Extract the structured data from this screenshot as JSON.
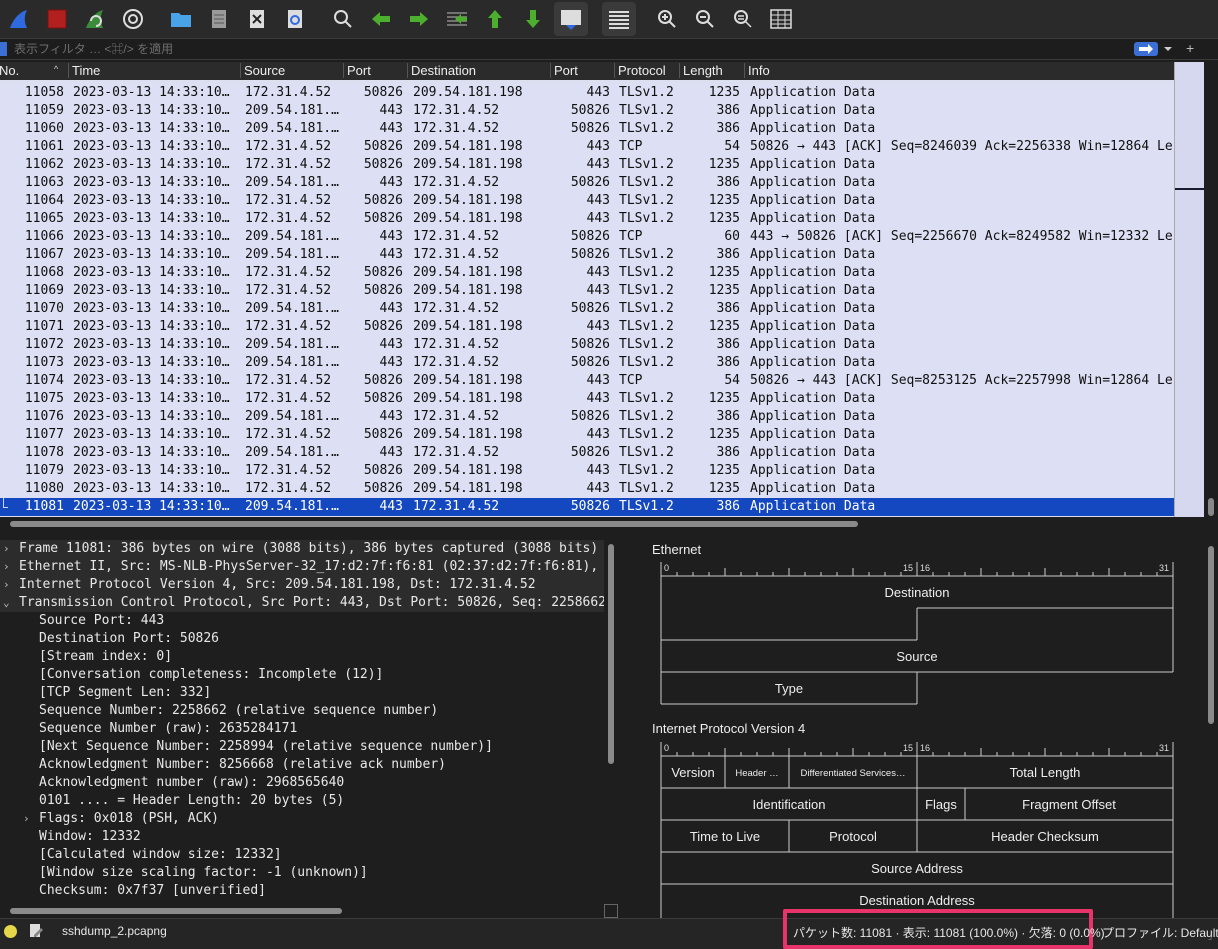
{
  "toolbar": {
    "buttons": [
      "shark-fin-icon",
      "stop-capture-icon",
      "restart-capture-icon",
      "capture-options-icon",
      "open-folder-icon",
      "file-document-icon",
      "close-file-icon",
      "reload-icon",
      "find-packet-icon",
      "go-back-icon",
      "go-forward-icon",
      "go-to-packet-icon",
      "go-first-icon",
      "go-last-icon",
      "auto-scroll-icon",
      "colorize-icon",
      "zoom-in-icon",
      "zoom-out-icon",
      "zoom-normal-icon",
      "resize-columns-icon"
    ]
  },
  "filter": {
    "placeholder": "表示フィルタ … <⌘/> を適用"
  },
  "packet_list": {
    "columns": [
      "No.",
      "Time",
      "Source",
      "Port",
      "Destination",
      "Port",
      "Protocol",
      "Length",
      "Info"
    ],
    "rows": [
      {
        "no": "11058",
        "time": "2023-03-13 14:33:10…",
        "src": "172.31.4.52",
        "sport": "50826",
        "dst": "209.54.181.198",
        "dport": "443",
        "proto": "TLSv1.2",
        "len": "1235",
        "info": "Application Data"
      },
      {
        "no": "11059",
        "time": "2023-03-13 14:33:10…",
        "src": "209.54.181.…",
        "sport": "443",
        "dst": "172.31.4.52",
        "dport": "50826",
        "proto": "TLSv1.2",
        "len": "386",
        "info": "Application Data"
      },
      {
        "no": "11060",
        "time": "2023-03-13 14:33:10…",
        "src": "209.54.181.…",
        "sport": "443",
        "dst": "172.31.4.52",
        "dport": "50826",
        "proto": "TLSv1.2",
        "len": "386",
        "info": "Application Data"
      },
      {
        "no": "11061",
        "time": "2023-03-13 14:33:10…",
        "src": "172.31.4.52",
        "sport": "50826",
        "dst": "209.54.181.198",
        "dport": "443",
        "proto": "TCP",
        "len": "54",
        "info": "50826 → 443 [ACK] Seq=8246039 Ack=2256338 Win=12864 Le"
      },
      {
        "no": "11062",
        "time": "2023-03-13 14:33:10…",
        "src": "172.31.4.52",
        "sport": "50826",
        "dst": "209.54.181.198",
        "dport": "443",
        "proto": "TLSv1.2",
        "len": "1235",
        "info": "Application Data"
      },
      {
        "no": "11063",
        "time": "2023-03-13 14:33:10…",
        "src": "209.54.181.…",
        "sport": "443",
        "dst": "172.31.4.52",
        "dport": "50826",
        "proto": "TLSv1.2",
        "len": "386",
        "info": "Application Data"
      },
      {
        "no": "11064",
        "time": "2023-03-13 14:33:10…",
        "src": "172.31.4.52",
        "sport": "50826",
        "dst": "209.54.181.198",
        "dport": "443",
        "proto": "TLSv1.2",
        "len": "1235",
        "info": "Application Data"
      },
      {
        "no": "11065",
        "time": "2023-03-13 14:33:10…",
        "src": "172.31.4.52",
        "sport": "50826",
        "dst": "209.54.181.198",
        "dport": "443",
        "proto": "TLSv1.2",
        "len": "1235",
        "info": "Application Data"
      },
      {
        "no": "11066",
        "time": "2023-03-13 14:33:10…",
        "src": "209.54.181.…",
        "sport": "443",
        "dst": "172.31.4.52",
        "dport": "50826",
        "proto": "TCP",
        "len": "60",
        "info": "443 → 50826 [ACK] Seq=2256670 Ack=8249582 Win=12332 Le"
      },
      {
        "no": "11067",
        "time": "2023-03-13 14:33:10…",
        "src": "209.54.181.…",
        "sport": "443",
        "dst": "172.31.4.52",
        "dport": "50826",
        "proto": "TLSv1.2",
        "len": "386",
        "info": "Application Data"
      },
      {
        "no": "11068",
        "time": "2023-03-13 14:33:10…",
        "src": "172.31.4.52",
        "sport": "50826",
        "dst": "209.54.181.198",
        "dport": "443",
        "proto": "TLSv1.2",
        "len": "1235",
        "info": "Application Data"
      },
      {
        "no": "11069",
        "time": "2023-03-13 14:33:10…",
        "src": "172.31.4.52",
        "sport": "50826",
        "dst": "209.54.181.198",
        "dport": "443",
        "proto": "TLSv1.2",
        "len": "1235",
        "info": "Application Data"
      },
      {
        "no": "11070",
        "time": "2023-03-13 14:33:10…",
        "src": "209.54.181.…",
        "sport": "443",
        "dst": "172.31.4.52",
        "dport": "50826",
        "proto": "TLSv1.2",
        "len": "386",
        "info": "Application Data"
      },
      {
        "no": "11071",
        "time": "2023-03-13 14:33:10…",
        "src": "172.31.4.52",
        "sport": "50826",
        "dst": "209.54.181.198",
        "dport": "443",
        "proto": "TLSv1.2",
        "len": "1235",
        "info": "Application Data"
      },
      {
        "no": "11072",
        "time": "2023-03-13 14:33:10…",
        "src": "209.54.181.…",
        "sport": "443",
        "dst": "172.31.4.52",
        "dport": "50826",
        "proto": "TLSv1.2",
        "len": "386",
        "info": "Application Data"
      },
      {
        "no": "11073",
        "time": "2023-03-13 14:33:10…",
        "src": "209.54.181.…",
        "sport": "443",
        "dst": "172.31.4.52",
        "dport": "50826",
        "proto": "TLSv1.2",
        "len": "386",
        "info": "Application Data"
      },
      {
        "no": "11074",
        "time": "2023-03-13 14:33:10…",
        "src": "172.31.4.52",
        "sport": "50826",
        "dst": "209.54.181.198",
        "dport": "443",
        "proto": "TCP",
        "len": "54",
        "info": "50826 → 443 [ACK] Seq=8253125 Ack=2257998 Win=12864 Le"
      },
      {
        "no": "11075",
        "time": "2023-03-13 14:33:10…",
        "src": "172.31.4.52",
        "sport": "50826",
        "dst": "209.54.181.198",
        "dport": "443",
        "proto": "TLSv1.2",
        "len": "1235",
        "info": "Application Data"
      },
      {
        "no": "11076",
        "time": "2023-03-13 14:33:10…",
        "src": "209.54.181.…",
        "sport": "443",
        "dst": "172.31.4.52",
        "dport": "50826",
        "proto": "TLSv1.2",
        "len": "386",
        "info": "Application Data"
      },
      {
        "no": "11077",
        "time": "2023-03-13 14:33:10…",
        "src": "172.31.4.52",
        "sport": "50826",
        "dst": "209.54.181.198",
        "dport": "443",
        "proto": "TLSv1.2",
        "len": "1235",
        "info": "Application Data"
      },
      {
        "no": "11078",
        "time": "2023-03-13 14:33:10…",
        "src": "209.54.181.…",
        "sport": "443",
        "dst": "172.31.4.52",
        "dport": "50826",
        "proto": "TLSv1.2",
        "len": "386",
        "info": "Application Data"
      },
      {
        "no": "11079",
        "time": "2023-03-13 14:33:10…",
        "src": "172.31.4.52",
        "sport": "50826",
        "dst": "209.54.181.198",
        "dport": "443",
        "proto": "TLSv1.2",
        "len": "1235",
        "info": "Application Data"
      },
      {
        "no": "11080",
        "time": "2023-03-13 14:33:10…",
        "src": "172.31.4.52",
        "sport": "50826",
        "dst": "209.54.181.198",
        "dport": "443",
        "proto": "TLSv1.2",
        "len": "1235",
        "info": "Application Data"
      },
      {
        "no": "11081",
        "time": "2023-03-13 14:33:10…",
        "src": "209.54.181.…",
        "sport": "443",
        "dst": "172.31.4.52",
        "dport": "50826",
        "proto": "TLSv1.2",
        "len": "386",
        "info": "Application Data",
        "selected": true
      }
    ]
  },
  "details": {
    "rows": [
      {
        "arrow": "›",
        "indent": 0,
        "top": true,
        "text": "Frame 11081: 386 bytes on wire (3088 bits), 386 bytes captured (3088 bits)"
      },
      {
        "arrow": "›",
        "indent": 0,
        "top": true,
        "text": "Ethernet II, Src: MS-NLB-PhysServer-32_17:d2:7f:f6:81 (02:37:d2:7f:f6:81),"
      },
      {
        "arrow": "›",
        "indent": 0,
        "top": true,
        "text": "Internet Protocol Version 4, Src: 209.54.181.198, Dst: 172.31.4.52"
      },
      {
        "arrow": "⌄",
        "indent": 0,
        "top": true,
        "text": "Transmission Control Protocol, Src Port: 443, Dst Port: 50826, Seq: 2258662"
      },
      {
        "arrow": "",
        "indent": 1,
        "text": "Source Port: 443"
      },
      {
        "arrow": "",
        "indent": 1,
        "text": "Destination Port: 50826"
      },
      {
        "arrow": "",
        "indent": 1,
        "text": "[Stream index: 0]"
      },
      {
        "arrow": "",
        "indent": 1,
        "text": "[Conversation completeness: Incomplete (12)]"
      },
      {
        "arrow": "",
        "indent": 1,
        "text": "[TCP Segment Len: 332]"
      },
      {
        "arrow": "",
        "indent": 1,
        "text": "Sequence Number: 2258662    (relative sequence number)"
      },
      {
        "arrow": "",
        "indent": 1,
        "text": "Sequence Number (raw): 2635284171"
      },
      {
        "arrow": "",
        "indent": 1,
        "text": "[Next Sequence Number: 2258994    (relative sequence number)]"
      },
      {
        "arrow": "",
        "indent": 1,
        "text": "Acknowledgment Number: 8256668    (relative ack number)"
      },
      {
        "arrow": "",
        "indent": 1,
        "text": "Acknowledgment number (raw): 2968565640"
      },
      {
        "arrow": "",
        "indent": 1,
        "text": "0101 .... = Header Length: 20 bytes (5)"
      },
      {
        "arrow": "›",
        "indent": 1,
        "text": "Flags: 0x018 (PSH, ACK)"
      },
      {
        "arrow": "",
        "indent": 1,
        "text": "Window: 12332"
      },
      {
        "arrow": "",
        "indent": 1,
        "text": "[Calculated window size: 12332]"
      },
      {
        "arrow": "",
        "indent": 1,
        "text": "[Window size scaling factor: -1 (unknown)]"
      },
      {
        "arrow": "",
        "indent": 1,
        "text": "Checksum: 0x7f37 [unverified]"
      }
    ]
  },
  "diagram": {
    "ethernet_title": "Ethernet",
    "ipv4_title": "Internet Protocol Version 4",
    "bit_labels": {
      "b0": "0",
      "b15": "15",
      "b16": "16",
      "b31": "31"
    },
    "ethernet_fields": {
      "destination": "Destination",
      "source": "Source",
      "type": "Type"
    },
    "ipv4_fields": {
      "version": "Version",
      "header_len": "Header …",
      "dsfield": "Differentiated Services…",
      "total_length": "Total Length",
      "identification": "Identification",
      "flags": "Flags",
      "fragment_offset": "Fragment Offset",
      "ttl": "Time to Live",
      "protocol": "Protocol",
      "header_checksum": "Header Checksum",
      "src_addr": "Source Address",
      "dst_addr": "Destination Address"
    }
  },
  "status": {
    "file": "sshdump_2.pcapng",
    "packets": "パケット数: 11081 · 表示: 11081 (100.0%) · 欠落: 0 (0.0%)",
    "profile": "プロファイル: Default"
  },
  "colors": {
    "row_bg": "#dde0f4",
    "selected_row": "#1448c0",
    "highlight_box": "#e8336b",
    "accent_blue": "#3b6fd6"
  }
}
